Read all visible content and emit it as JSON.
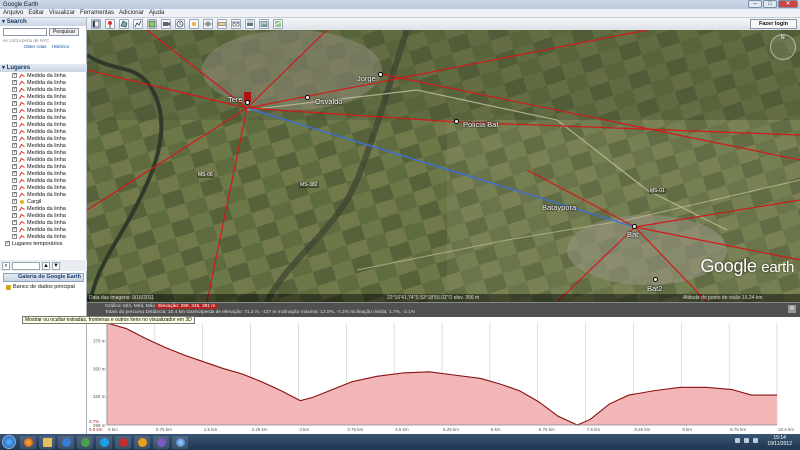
{
  "window": {
    "title": "Google Earth"
  },
  "menu": [
    "Arquivo",
    "Editar",
    "Visualizar",
    "Ferramentas",
    "Adicionar",
    "Ajuda"
  ],
  "toolbar": {
    "login_label": "Fazer login"
  },
  "search": {
    "header": "Search",
    "button": "Pesquisar",
    "hint": "ex: pizza perto de NYC",
    "links": [
      "Obter rotas",
      "Histórico"
    ]
  },
  "places": {
    "header": "Lugares",
    "items": [
      "Medida da linha",
      "Medida da linha",
      "Medida da linha",
      "Medida da linha",
      "Medida da linha",
      "Medida da linha",
      "Medida da linha",
      "Medida da linha",
      "Medida da linha",
      "Medida da linha",
      "Medida da linha",
      "Medida da linha",
      "Medida da linha",
      "Medida da linha",
      "Medida da linha",
      "Medida da linha",
      "Medida da linha",
      "Medida da linha",
      "Cargil",
      "Medida da linha",
      "Medida da linha",
      "Medida da linha",
      "Medida da linha",
      "Medida da linha"
    ],
    "temp": "Lugares temporários",
    "gallery": "Galeria do Google Earth",
    "db": "Banco de dados principal"
  },
  "map": {
    "labels": [
      {
        "text": "Jorge"
      },
      {
        "text": "Osvaldo"
      },
      {
        "text": "Tere"
      },
      {
        "text": "Policia Bat"
      },
      {
        "text": "Bataypora"
      },
      {
        "text": "Bat"
      },
      {
        "text": "Bat2"
      }
    ],
    "road_labels": [
      "MS-382",
      "MS-01",
      "MS-06"
    ],
    "imagery_date": "Data das imagens: 9/16/2011",
    "coords": "22°16'41.74\"S  53°18'55.02\"O  elev.  356 m",
    "eye_alt": "Altitude do ponto de visão  16.24 km",
    "logo_1": "Google",
    "logo_2": "earth"
  },
  "profile": {
    "row1": "Gráfico: Mín, Méd, Máx",
    "row1_hl": "Elevação: 299, 345, 391 m",
    "row2": "Totais do percurso  Distância: 10.4 km   Ganho/perda de elevação: 71.3 m, -137 m   Inclinação máxima: 12.0%, -7.2%   Inclinação média: 1.7%, -2.1%",
    "tooltip": "Mostrar ou ocultar estradas, fronteiras e outros itens no visualizador em 3D",
    "y_ticks": [
      "375 m",
      "350 m",
      "325 m",
      "299 m"
    ],
    "x_ticks": [
      "0 km",
      "0.75 km",
      "1.5 km",
      "2.25 km",
      "3 km",
      "3.75 km",
      "4.5 km",
      "5.25 km",
      "6 km",
      "6.75 km",
      "7.5 km",
      "8.25 km",
      "9 km",
      "9.75 km",
      "10.4 km"
    ],
    "left_mark": "0.7%",
    "left_mark2": "0.5 km"
  },
  "chart_data": {
    "type": "area",
    "title": "",
    "xlabel": "",
    "ylabel": "",
    "xlim": [
      0,
      10.4
    ],
    "ylim": [
      299,
      391
    ],
    "series": [
      {
        "x": [
          0,
          0.3,
          0.6,
          0.9,
          1.2,
          1.5,
          1.8,
          2.1,
          2.4,
          2.7,
          3.0,
          3.2,
          3.5,
          3.8,
          4.2,
          4.6,
          5.0,
          5.4,
          5.8,
          6.1,
          6.4,
          6.7,
          7.0,
          7.3,
          7.5,
          7.8,
          8.1,
          8.5,
          8.9,
          9.3,
          9.7,
          10.0,
          10.4
        ],
        "values": [
          391,
          386,
          377,
          369,
          362,
          356,
          350,
          345,
          338,
          330,
          321,
          324,
          331,
          338,
          343,
          346,
          347,
          344,
          341,
          336,
          330,
          320,
          307,
          299,
          304,
          318,
          326,
          330,
          333,
          333,
          331,
          326,
          326
        ]
      }
    ]
  },
  "taskbar": {
    "time": "15:14",
    "date": "19/11/2012"
  },
  "colors": {
    "line_red": "#d21919",
    "line_blue": "#3c6fd8",
    "profile_fill": "#f2b6b6",
    "profile_line": "#8a1010"
  }
}
